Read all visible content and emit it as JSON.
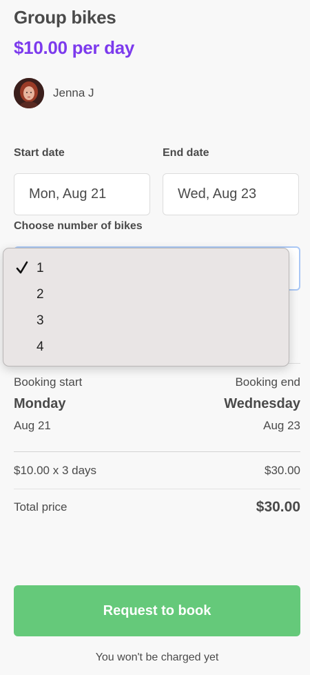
{
  "listing": {
    "title": "Group bikes",
    "price": "$10.00 per day"
  },
  "host": {
    "name": "Jenna J"
  },
  "form": {
    "start_label": "Start date",
    "end_label": "End date",
    "start_value": "Mon, Aug 21",
    "end_value": "Wed, Aug 23",
    "bikes_label": "Choose number of bikes",
    "bikes_selected": "1",
    "bikes_options": [
      "1",
      "2",
      "3",
      "4"
    ]
  },
  "booking": {
    "start_label": "Booking start",
    "end_label": "Booking end",
    "start_day": "Monday",
    "end_day": "Wednesday",
    "start_date": "Aug 21",
    "end_date": "Aug 23"
  },
  "breakdown": {
    "line_label": "$10.00 x 3 days",
    "line_value": "$30.00",
    "total_label": "Total price",
    "total_value": "$30.00"
  },
  "cta": {
    "label": "Request to book",
    "note": "You won't be charged yet"
  },
  "colors": {
    "accent": "#7c3aed",
    "button": "#65c97a",
    "focus_border": "#a9c7f5"
  }
}
